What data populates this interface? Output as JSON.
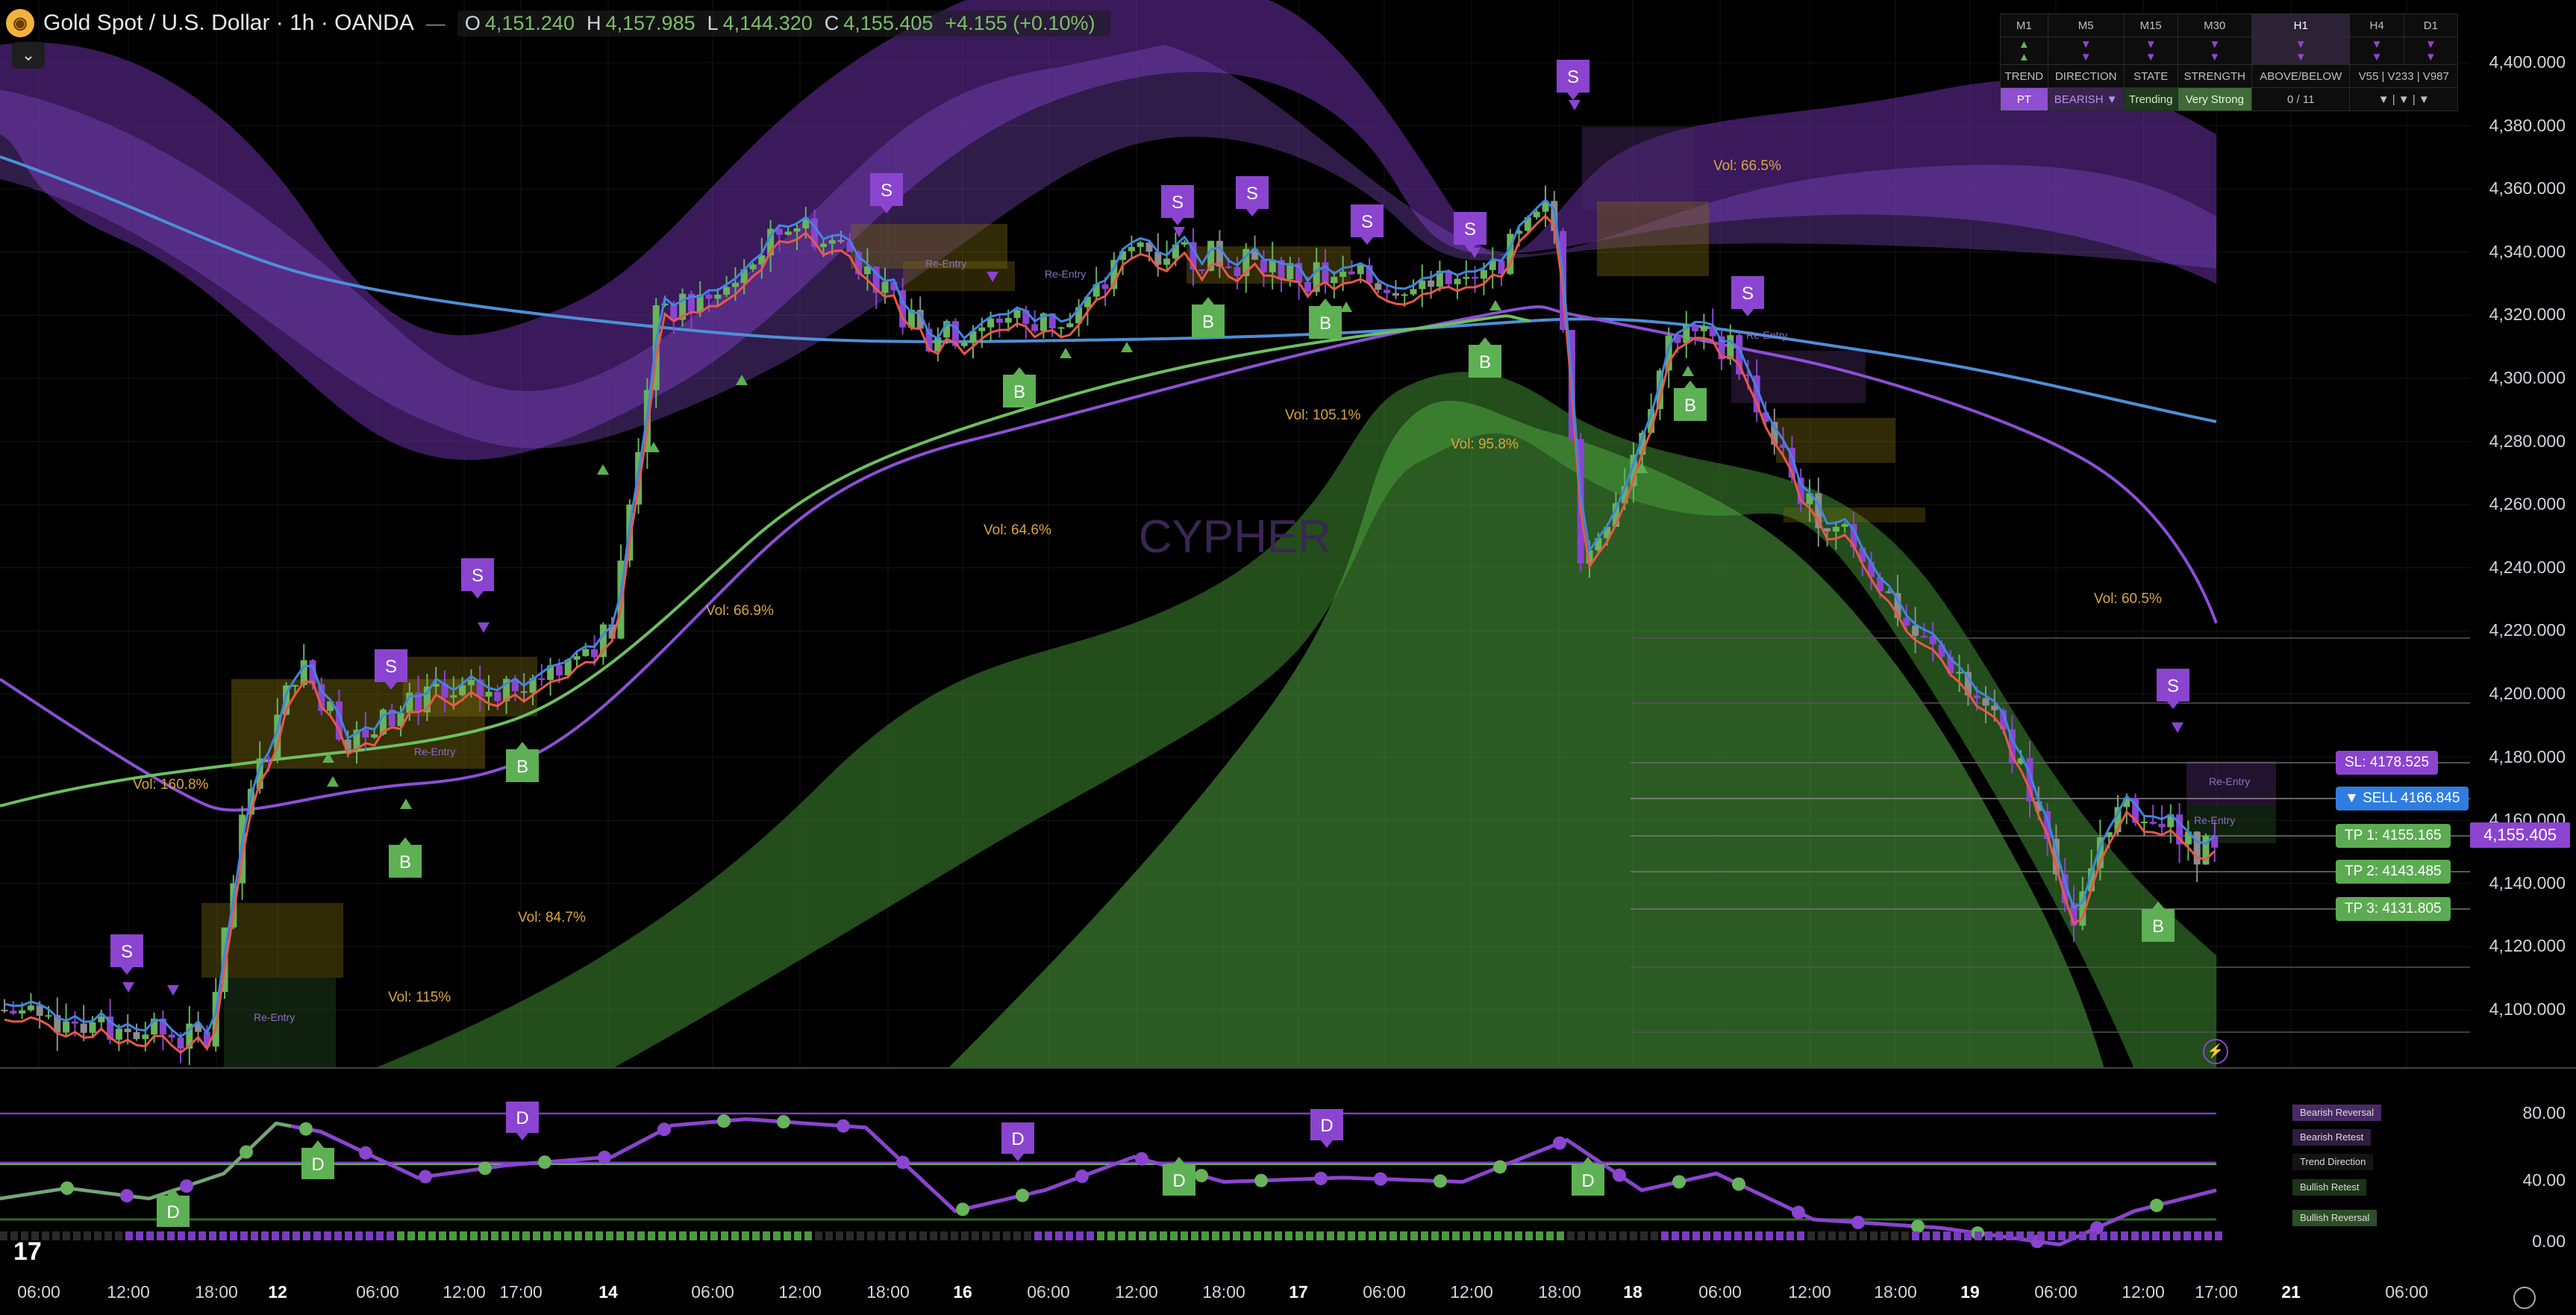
{
  "header": {
    "symbol": "Gold Spot / U.S. Dollar · 1h · OANDA",
    "o_label": "O",
    "o": "4,151.240",
    "h_label": "H",
    "h": "4,157.985",
    "l_label": "L",
    "l": "4,144.320",
    "c_label": "C",
    "c": "4,155.405",
    "change": "+4.155 (+0.10%)"
  },
  "mtf_table": {
    "timeframes": [
      "M1",
      "M5",
      "M15",
      "M30",
      "H1",
      "H4",
      "D1"
    ],
    "headers": [
      "TREND",
      "DIRECTION",
      "STATE",
      "STRENGTH",
      "ABOVE/BELOW",
      "V55 | V233 | V987"
    ],
    "values": [
      "PT",
      "BEARISH ▼",
      "Trending",
      "Very Strong",
      "0 / 11",
      "▼ | ▼ | ▼"
    ],
    "active_tf": "H1"
  },
  "price_axis": [
    "4,400.000",
    "4,380.000",
    "4,360.000",
    "4,340.000",
    "4,320.000",
    "4,300.000",
    "4,280.000",
    "4,260.000",
    "4,240.000",
    "4,220.000",
    "4,200.000",
    "4,180.000",
    "4,160.000",
    "4,140.000",
    "4,120.000",
    "4,100.000"
  ],
  "current_price": "4,155.405",
  "trade_labels": {
    "sl": "SL: 4178.525",
    "sell": "▼ SELL 4166.845",
    "tp1": "TP 1: 4155.165",
    "tp2": "TP 2: 4143.485",
    "tp3": "TP 3: 4131.805"
  },
  "watermark": "CYPHER",
  "vol_labels": [
    "Vol: 160.8%",
    "Vol: 115%",
    "Vol: 84.7%",
    "Vol: 66.9%",
    "Vol: 64.6%",
    "Vol: 105.1%",
    "Vol: 95.8%",
    "Vol: 66.5%",
    "Vol: 60.5%"
  ],
  "re_entry": "Re-Entry",
  "signal_letters": {
    "sell": "S",
    "buy": "B",
    "divergence": "D"
  },
  "osc_axis": [
    "80.00",
    "40.00",
    "0.00"
  ],
  "osc_legend": [
    "Bearish Reversal",
    "Bearish Retest",
    "Trend Direction",
    "Bullish Retest",
    "Bullish Reversal"
  ],
  "time_axis": [
    "06:00",
    "12:00",
    "18:00",
    "12",
    "06:00",
    "12:00",
    "17:00",
    "14",
    "06:00",
    "12:00",
    "18:00",
    "16",
    "06:00",
    "12:00",
    "18:00",
    "17",
    "06:00",
    "12:00",
    "18:00",
    "18",
    "06:00",
    "12:00",
    "18:00",
    "19",
    "06:00",
    "12:00",
    "17:00",
    "21",
    "06:00"
  ],
  "colors": {
    "bull": "#67b35c",
    "bear": "#8b44d0",
    "gray": "#8c8c8c",
    "ema_fast": "#3f86e0",
    "ema_red": "#e8574a",
    "ema_green": "#6cc060",
    "ma_blue": "#4d8fd6",
    "ma_purple": "#8d4fd6"
  }
}
